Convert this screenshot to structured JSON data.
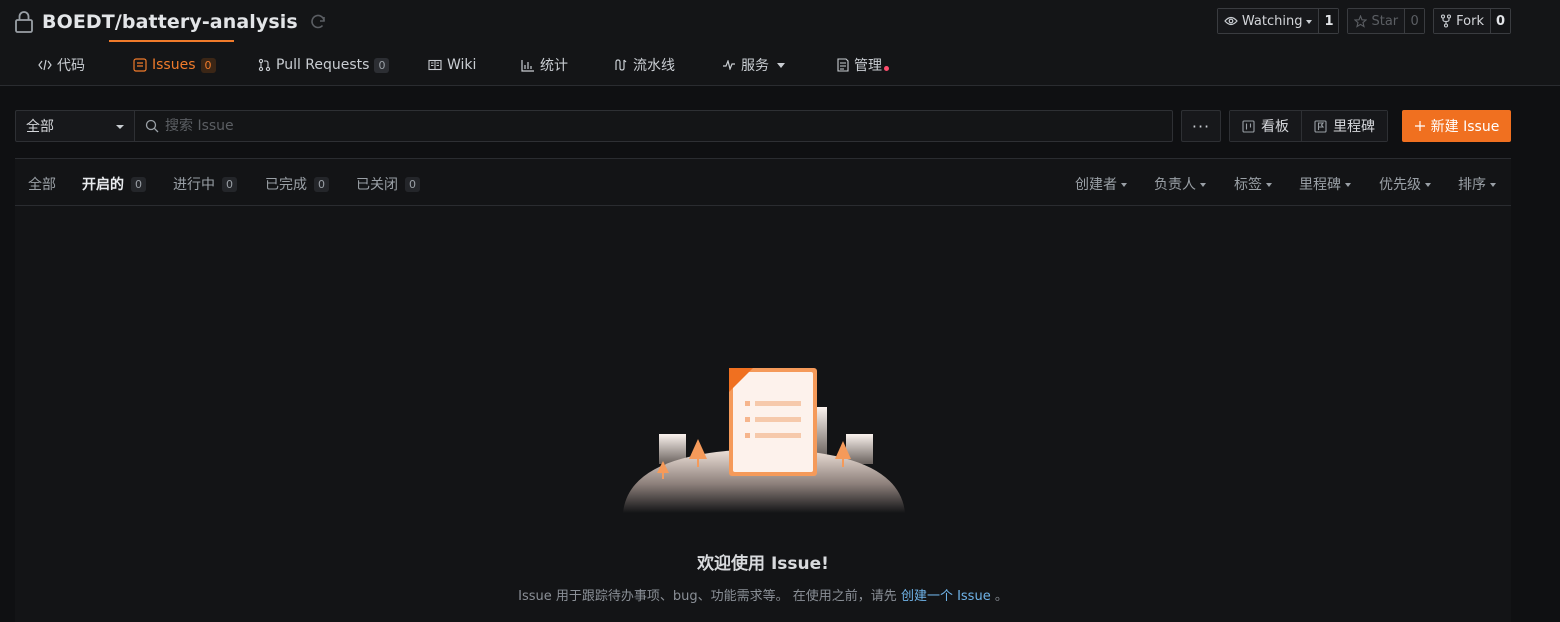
{
  "repo": {
    "name": "BOEDT/battery-analysis",
    "actions": [
      {
        "label": "Watching",
        "count": "1",
        "has_caret": true,
        "dim": false,
        "icon": "eye-icon"
      },
      {
        "label": "Star",
        "count": "0",
        "has_caret": false,
        "dim": true,
        "icon": "star-icon"
      },
      {
        "label": "Fork",
        "count": "0",
        "has_caret": false,
        "dim": false,
        "icon": "fork-icon"
      }
    ]
  },
  "tabs": [
    {
      "label": "代码",
      "icon": "code-icon"
    },
    {
      "label": "Issues",
      "count": "0",
      "icon": "issues-icon",
      "active": true
    },
    {
      "label": "Pull Requests",
      "count": "0",
      "icon": "pull-request-icon"
    },
    {
      "label": "Wiki",
      "icon": "wiki-icon"
    },
    {
      "label": "统计",
      "icon": "chart-icon"
    },
    {
      "label": "流水线",
      "icon": "pipeline-icon"
    },
    {
      "label": "服务",
      "icon": "pulse-icon"
    },
    {
      "label": "管理",
      "icon": "manage-icon"
    }
  ],
  "toolbar": {
    "scope_value": "全部",
    "search_placeholder": "搜索 Issue",
    "more_label": "···",
    "board_label": "看板",
    "milestone_label": "里程碑",
    "new_issue_label": "新建 Issue"
  },
  "state_filters": [
    {
      "label": "全部"
    },
    {
      "label": "开启的",
      "count": "0"
    },
    {
      "label": "进行中",
      "count": "0"
    },
    {
      "label": "已完成",
      "count": "0"
    },
    {
      "label": "已关闭",
      "count": "0"
    }
  ],
  "sort_filters": [
    "创建者",
    "负责人",
    "标签",
    "里程碑",
    "优先级",
    "排序"
  ],
  "empty": {
    "title": "欢迎使用 Issue!",
    "desc_before": "Issue 用于跟踪待办事项、bug、功能需求等。 在使用之前，请先 ",
    "link": "创建一个 Issue",
    "desc_after": " 。"
  },
  "colors": {
    "accent": "#f07020",
    "background": "#0f1012",
    "link": "#6fb3e8"
  }
}
